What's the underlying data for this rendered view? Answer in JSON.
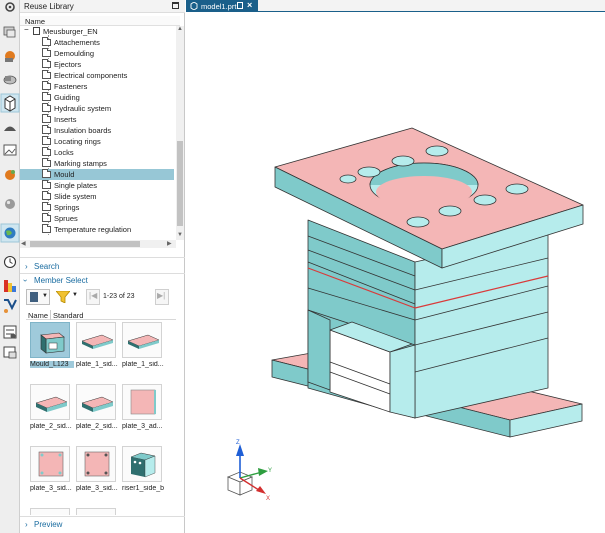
{
  "panel": {
    "title": "Reuse Library",
    "column_header": "Name",
    "root": "Meusburger_EN",
    "items": [
      "Attachements",
      "Demoulding",
      "Ejectors",
      "Electrical components",
      "Fasteners",
      "Guiding",
      "Hydraulic system",
      "Inserts",
      "Insulation boards",
      "Locating rings",
      "Locks",
      "Marking stamps",
      "Mould",
      "Single plates",
      "Slide system",
      "Springs",
      "Sprues",
      "Temperature regulation"
    ],
    "selected_item": "Mould"
  },
  "search": {
    "label": "Search"
  },
  "member_select": {
    "label": "Member Select",
    "paging": "1-23 of 23",
    "columns": [
      "Name",
      "Standard"
    ],
    "tiles": [
      "Mould_L123",
      "plate_1_sid...",
      "plate_1_sid...",
      "plate_2_sid...",
      "plate_2_sid...",
      "plate_3_ad...",
      "plate_3_sid...",
      "plate_3_sid...",
      "riser1_side_b"
    ]
  },
  "preview": {
    "label": "Preview"
  },
  "tab": {
    "title": "model1.prt"
  },
  "colors": {
    "accent": "#1a5f8a",
    "selection": "#97c7d6",
    "model_top": "#f4b6b6",
    "model_side": "#b6ecec",
    "model_dark": "#7fcaca",
    "link": "#1a6ca0"
  },
  "icons": [
    "settings-icon",
    "assembly-icon",
    "part-navigator-icon",
    "parts-icon",
    "reuse-library-icon",
    "hd3d-icon",
    "web-browser-icon",
    "history-icon",
    "system-materials-icon",
    "process-studio-icon",
    "roles-icon",
    "knowledge-icon"
  ]
}
